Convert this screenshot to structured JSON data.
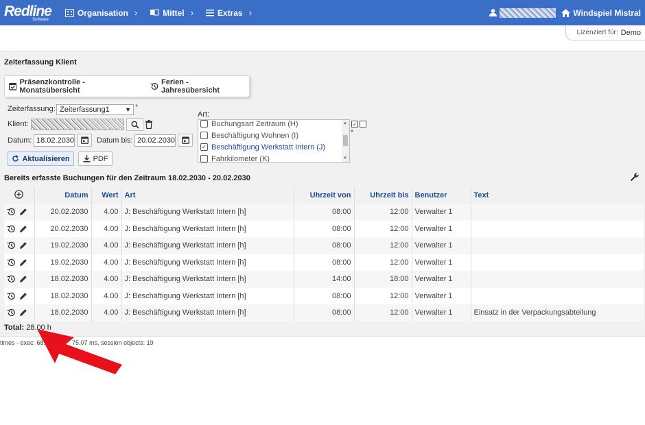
{
  "nav": {
    "logo": "Redline",
    "logo_sub": "Software",
    "items": [
      {
        "label": "Organisation",
        "icon": "building-icon"
      },
      {
        "label": "Mittel",
        "icon": "book-icon"
      },
      {
        "label": "Extras",
        "icon": "menu-icon"
      }
    ],
    "chevron": "›",
    "location": "Windspiel Mistral"
  },
  "license": {
    "label": "Lizenziert für:",
    "value": "Demo"
  },
  "page": {
    "title": "Zeiterfassung Klient",
    "tabs": [
      {
        "label": "Präsenzkontrolle - Monatsübersicht",
        "icon": "calendar-check-icon"
      },
      {
        "label": "Ferien - Jahresübersicht",
        "icon": "history-icon"
      }
    ]
  },
  "form": {
    "zeiterfassung_label": "Zeiterfassung:",
    "zeiterfassung_value": "Zeiterfassung1",
    "required_mark": "*",
    "klient_label": "Klient:",
    "datum_label": "Datum:",
    "datum_value": "18.02.2030",
    "datum_bis_label": "Datum bis:",
    "datum_bis_value": "20.02.2030",
    "refresh_label": "Aktualisieren",
    "pdf_label": "PDF",
    "art_label": "Art:",
    "art_items": [
      {
        "label": "Buchungsart Zeitraum (H)",
        "checked": false
      },
      {
        "label": "Beschäftigung Wohnen (I)",
        "checked": false
      },
      {
        "label": "Beschäftigung Werkstatt Intern (J)",
        "checked": true
      },
      {
        "label": "Fahrkilometer (K)",
        "checked": false
      }
    ]
  },
  "table": {
    "title": "Bereits erfasste Buchungen für den Zeitraum 18.02.2030 - 20.02.2030",
    "headers": {
      "datum": "Datum",
      "wert": "Wert",
      "art": "Art",
      "von": "Uhrzeit von",
      "bis": "Uhrzeit bis",
      "benutzer": "Benutzer",
      "text": "Text"
    },
    "rows": [
      {
        "datum": "20.02.2030",
        "wert": "4.00",
        "art": "J: Beschäftigung Werkstatt Intern [h]",
        "von": "08:00",
        "bis": "12:00",
        "benutzer": "Verwalter 1",
        "text": ""
      },
      {
        "datum": "20.02.2030",
        "wert": "4.00",
        "art": "J: Beschäftigung Werkstatt Intern [h]",
        "von": "08:00",
        "bis": "12:00",
        "benutzer": "Verwalter 1",
        "text": ""
      },
      {
        "datum": "19.02.2030",
        "wert": "4.00",
        "art": "J: Beschäftigung Werkstatt Intern [h]",
        "von": "08:00",
        "bis": "12:00",
        "benutzer": "Verwalter 1",
        "text": ""
      },
      {
        "datum": "19.02.2030",
        "wert": "4.00",
        "art": "J: Beschäftigung Werkstatt Intern [h]",
        "von": "08:00",
        "bis": "12:00",
        "benutzer": "Verwalter 1",
        "text": ""
      },
      {
        "datum": "18.02.2030",
        "wert": "4.00",
        "art": "J: Beschäftigung Werkstatt Intern [h]",
        "von": "14:00",
        "bis": "18:00",
        "benutzer": "Verwalter 1",
        "text": ""
      },
      {
        "datum": "18.02.2030",
        "wert": "4.00",
        "art": "J: Beschäftigung Werkstatt Intern [h]",
        "von": "08:00",
        "bis": "12:00",
        "benutzer": "Verwalter 1",
        "text": ""
      },
      {
        "datum": "18.02.2030",
        "wert": "4.00",
        "art": "J: Beschäftigung Werkstatt Intern [h]",
        "von": "08:00",
        "bis": "12:00",
        "benutzer": "Verwalter 1",
        "text": "Einsatz in der Verpackungsabteilung"
      }
    ],
    "total_label": "Total:",
    "total_value": "28.00 h"
  },
  "footer": {
    "times": "times - exec: 68.8",
    "session": "75.07 ms, session objects: 19"
  },
  "colors": {
    "nav": "#3b6fc7",
    "link": "#1d4b96",
    "arrow": "#e8101a"
  }
}
